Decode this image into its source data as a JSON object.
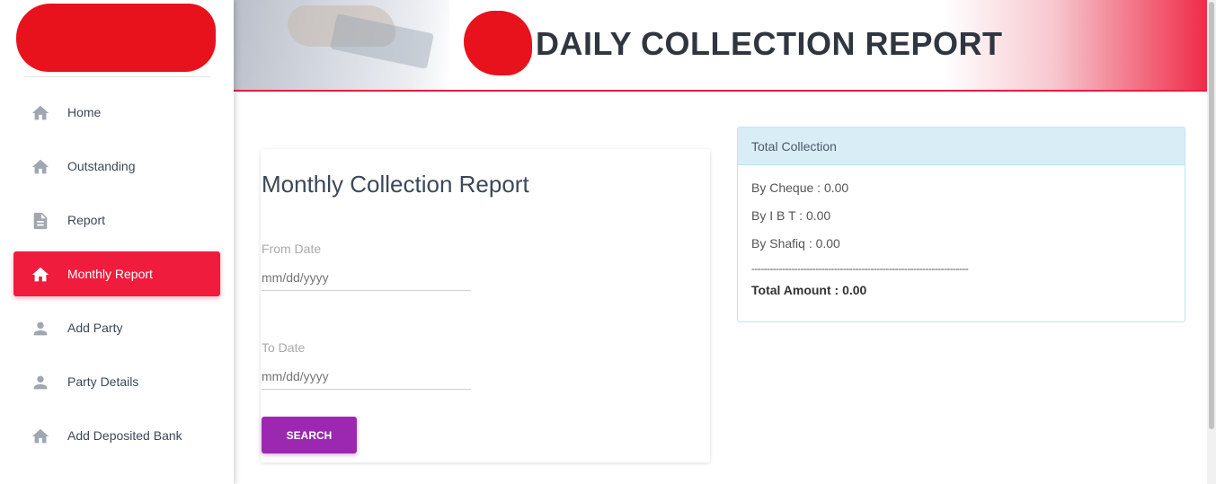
{
  "header": {
    "title": "DAILY COLLECTION REPORT"
  },
  "sidebar": {
    "items": [
      {
        "label": "Home",
        "icon": "home-icon",
        "active": false
      },
      {
        "label": "Outstanding",
        "icon": "home-icon",
        "active": false
      },
      {
        "label": "Report",
        "icon": "document-icon",
        "active": false
      },
      {
        "label": "Monthly Report",
        "icon": "home-icon",
        "active": true
      },
      {
        "label": "Add Party",
        "icon": "person-icon",
        "active": false
      },
      {
        "label": "Party Details",
        "icon": "person-icon",
        "active": false
      },
      {
        "label": "Add Deposited Bank",
        "icon": "home-icon",
        "active": false
      }
    ]
  },
  "form": {
    "title": "Monthly Collection Report",
    "from_label": "From Date",
    "from_placeholder": "mm/dd/yyyy",
    "to_label": "To Date",
    "to_placeholder": "mm/dd/yyyy",
    "search_label": "SEARCH"
  },
  "summary": {
    "heading": "Total Collection",
    "cheque": "By Cheque : 0.00",
    "ibt": "By I B T : 0.00",
    "shafiq": "By Shafiq : 0.00",
    "separator": "-----------------------------------------------------------------------",
    "total": "Total Amount : 0.00"
  },
  "colors": {
    "accent_red": "#ef1c3e",
    "button_purple": "#9c27b0",
    "panel_head": "#d9edf7"
  }
}
